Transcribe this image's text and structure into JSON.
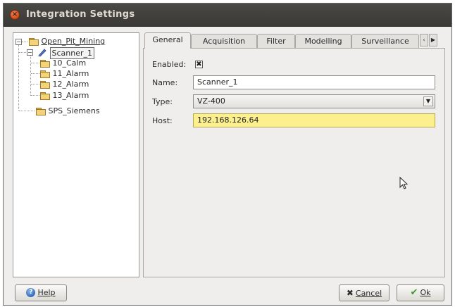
{
  "window": {
    "title": "Integration Settings",
    "close_glyph": "×"
  },
  "tree": {
    "root": {
      "label": "Open_Pit_Mining",
      "expander": "−"
    },
    "scanner": {
      "label": "Scanner_1",
      "expander": "−"
    },
    "children": [
      {
        "label": "10_Calm"
      },
      {
        "label": "11_Alarm"
      },
      {
        "label": "12_Alarm"
      },
      {
        "label": "13_Alarm"
      }
    ],
    "plc": {
      "label": "SPS_Siemens"
    }
  },
  "tabs": [
    {
      "label": "General",
      "active": true
    },
    {
      "label": "Acquisition"
    },
    {
      "label": "Filter"
    },
    {
      "label": "Modelling"
    },
    {
      "label": "Surveillance"
    }
  ],
  "tab_scroll": {
    "left": "‹",
    "right": "▶"
  },
  "form": {
    "enabled_label": "Enabled:",
    "enabled_checked": true,
    "enabled_glyph": "✖",
    "name_label": "Name:",
    "name_value": "Scanner_1",
    "type_label": "Type:",
    "type_value": "VZ-400",
    "type_arrow": "▼",
    "host_label": "Host:",
    "host_value": "192.168.126.64",
    "host_highlight_color": "#fbf08d"
  },
  "buttons": {
    "help_icon": "?",
    "help_label": "Help",
    "cancel_icon": "✖",
    "cancel_label": "Cancel",
    "ok_icon": "✔",
    "ok_label": "Ok"
  },
  "icons": {
    "title_close": "close-icon",
    "folder": "folder-icon",
    "scanner": "pencil-icon",
    "cursor": "mouse-cursor-icon"
  }
}
